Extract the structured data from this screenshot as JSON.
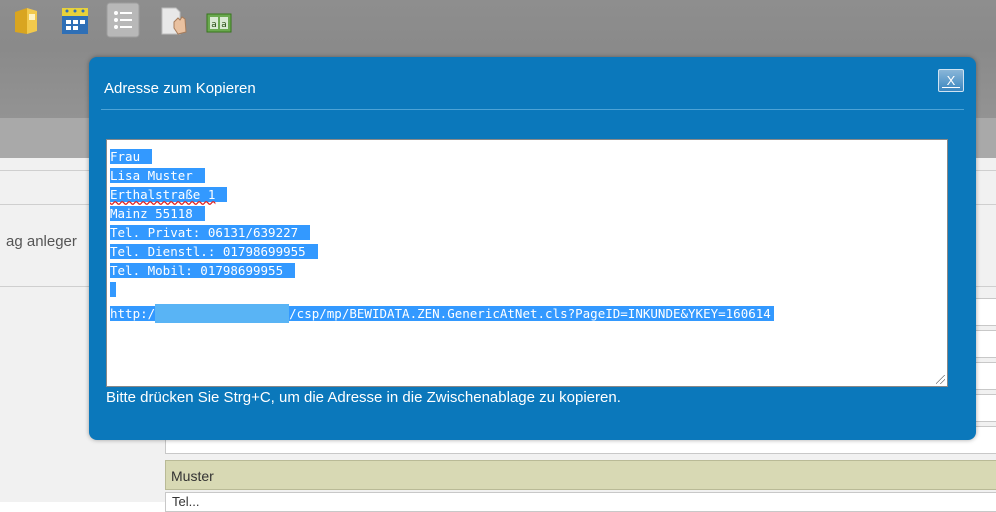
{
  "toolbar": {
    "icons": [
      "folder-icon",
      "calendar-icon",
      "list-icon",
      "hand-icon",
      "abc-icon"
    ]
  },
  "background": {
    "partial_button_label": "ag anleger",
    "name_field_value": "Muster",
    "next_field_value": "Tel..."
  },
  "dialog": {
    "title": "Adresse zum Kopieren",
    "close_label": "X",
    "address_lines": [
      "Frau",
      "Lisa Muster",
      "Erthalstraße 1",
      "Mainz 55118",
      "Tel. Privat: 06131/639227",
      "Tel. Dienstl.: 01798699955",
      "Tel. Mobil: 01798699955",
      ""
    ],
    "url_prefix": "http:/",
    "url_suffix": "/csp/mp/BEWIDATA.ZEN.GenericAtNet.cls?PageID=INKUNDE&YKEY=160614",
    "hint": "Bitte drücken Sie Strg+C, um die Adresse in die Zwischenablage zu kopieren."
  },
  "colors": {
    "dialog_bg": "#0b78bb",
    "selection": "#3399ff",
    "name_field": "#d8d9b4"
  }
}
